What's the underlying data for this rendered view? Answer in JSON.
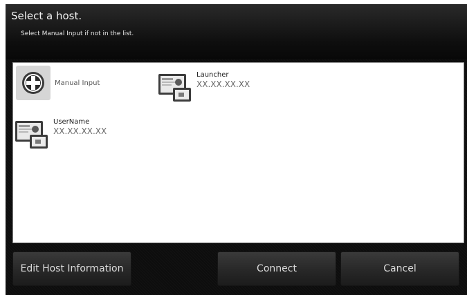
{
  "header": {
    "title": "Select a host.",
    "subtitle": "Select Manual Input if not in the list."
  },
  "hosts": [
    {
      "label": "Manual Input",
      "icon": "add-icon"
    },
    {
      "name": "Launcher",
      "ip": "XX.XX.XX.XX",
      "icon": "host-computer-icon"
    },
    {
      "name": "UserName",
      "ip": "XX.XX.XX.XX",
      "icon": "host-computer-icon"
    }
  ],
  "buttons": {
    "edit": "Edit Host Information",
    "connect": "Connect",
    "cancel": "Cancel"
  },
  "colors": {
    "dialog_background": "#0d0d0d",
    "list_background": "#ffffff",
    "button_text": "#dcdcdc"
  }
}
